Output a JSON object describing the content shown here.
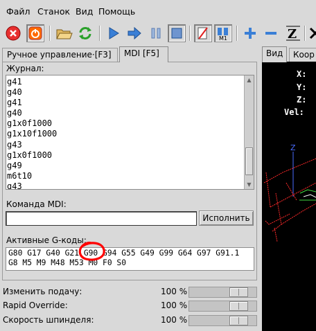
{
  "menu": [
    "Файл",
    "Станок",
    "Вид",
    "Помощь"
  ],
  "toolbar": {
    "icons": [
      "estop-icon",
      "power-icon",
      "open-file-icon",
      "reload-icon",
      "run-icon",
      "step-icon",
      "pause-icon",
      "stop-icon",
      "block-delete-icon",
      "optional-stop-icon",
      "zoom-in-icon",
      "zoom-out-icon",
      "view-z-icon"
    ],
    "m1_label": "M1"
  },
  "tabs": {
    "manual": "Ручное управление·[F3]",
    "mdi": "MDI [F5]"
  },
  "journal": {
    "label": "Журнал:",
    "lines": [
      "g41",
      "g40",
      "g41",
      "g40",
      "g1x0f1000",
      "g1x10f1000",
      "g43",
      "g1x0f1000",
      "g49",
      "m6t10",
      "g43"
    ]
  },
  "mdi_command": {
    "label": "Команда MDI:",
    "value": "",
    "execute_label": "Исполнить"
  },
  "active_gcodes": {
    "label": "Активные G-коды:",
    "line1": "G80 G17 G40 G21 G90 G94 G55 G49 G99 G64 G97 G91.1",
    "line2": "G8 M5 M9 M48 M53 M0 F0 S0",
    "highlight": "G90",
    "highlight_color": "#ff0000"
  },
  "overrides": [
    {
      "label": "Изменить подачу:",
      "value": "100 %",
      "level": 1.0
    },
    {
      "label": "Rapid Override:",
      "value": "100 %",
      "level": 1.0
    },
    {
      "label": "Скорость шпинделя:",
      "value": "100 %",
      "level": 1.0
    }
  ],
  "right_panel": {
    "tabs": [
      "Вид",
      "Коор"
    ],
    "dro": [
      "X:",
      "Y:",
      "Z:",
      "Vel:"
    ],
    "axis_z": "Z",
    "axis_y": "Y"
  },
  "colors": {
    "estop": "#e83030",
    "power": "#ff6a00",
    "accent_blue": "#3a7fd6",
    "view_bg": "#000000",
    "toolpath": "#ff2a2a",
    "axis_blue": "#4a6cff"
  }
}
